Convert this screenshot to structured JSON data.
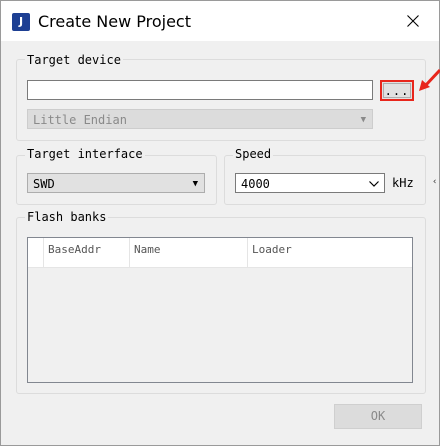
{
  "window": {
    "title": "Create New Project",
    "app_icon_text": "J",
    "close_glyph": "✕"
  },
  "target_device": {
    "label": "Target device",
    "device_value": "",
    "browse_label": "...",
    "endian_value": "Little Endian",
    "highlight_color": "#e8261c"
  },
  "target_interface": {
    "label": "Target interface",
    "value": "SWD"
  },
  "speed": {
    "label": "Speed",
    "value": "4000",
    "unit": "kHz"
  },
  "flash_banks": {
    "label": "Flash banks",
    "columns": [
      "BaseAddr",
      "Name",
      "Loader"
    ],
    "rows": []
  },
  "buttons": {
    "ok": "OK"
  },
  "icons": {
    "dropdown": "dropdown-arrow-icon",
    "chevron": "chevron-down-icon",
    "close": "close-icon",
    "annotation": "red-arrow-icon"
  }
}
